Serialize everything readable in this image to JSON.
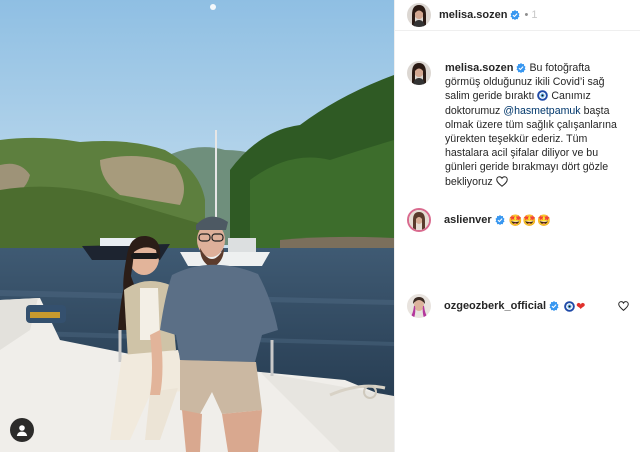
{
  "post": {
    "author": "melisa.sozen",
    "follow_label": "1",
    "caption_part1": "Bu fotoğrafta görmüş olduğunuz ikili Covid’i sağ salim geride bıraktı",
    "caption_part2": "Canımız doktorumuz",
    "caption_mention": "@hasmetpamuk",
    "caption_part3": "başta olmak üzere tüm sağlık çalışanlarına yürekten teşekkür ederiz. Tüm hastalara acil şifalar diliyor ve bu günleri geride bırakmayı dört gözle bekliyoruz"
  },
  "comments": [
    {
      "user": "aslienver",
      "text": "🤩🤩🤩"
    },
    {
      "user": "ozgeozberk_official",
      "text": "❤"
    }
  ],
  "colors": {
    "verified": "#3897f0",
    "mention": "#00376b",
    "heart": "#e0302c",
    "evil_eye": "#1f4aa8"
  },
  "icons": {
    "verified": "verified-badge-icon",
    "evil_eye": "nazar-eye-icon",
    "like": "heart-outline-icon",
    "user_tag": "user-tag-icon"
  }
}
